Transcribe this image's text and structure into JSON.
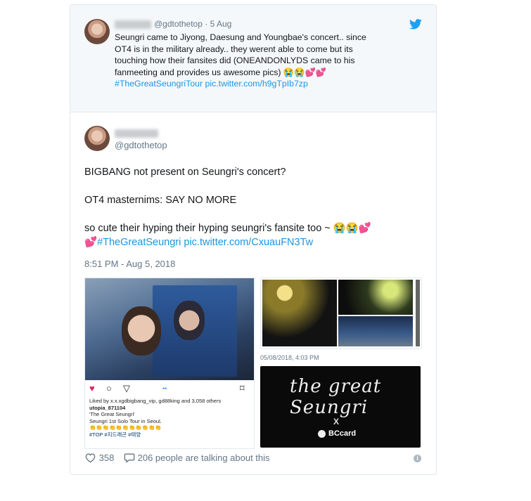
{
  "quoted_tweet": {
    "handle": "@gdtothetop",
    "separator": "·",
    "date": "5 Aug",
    "text_line1": "Seungri came to Jiyong, Daesung and Youngbae's concert.. since",
    "text_line2": "OT4 is in the military already.. they werent able to come but its",
    "text_line3": "touching how their fansites did (ONEANDONLYDS came to his",
    "text_line4": "fanmeeting and provides us awesome pics) 😭😭💕💕",
    "hashtag": "#TheGreatSeungriTour",
    "link": "pic.twitter.com/h9gTpIb7zp"
  },
  "main_tweet": {
    "handle": "@gdtothetop",
    "line1": "BIGBANG not present on Seungri's concert?",
    "line2": "OT4 masternims: SAY NO MORE",
    "line3": "so cute their hyping their hyping seungri's fansite too ~ 😭😭💕",
    "line4_prefix": "💕",
    "hashtag": "#TheGreatSeungri",
    "link": "pic.twitter.com/CxuauFN3Tw",
    "timestamp": "8:51 PM - Aug 5, 2018"
  },
  "media": {
    "instagram": {
      "likes": "Liked by x.x.xgdbigbang_vip, gd88king and 3,058 others",
      "user": "utopia_871104",
      "caption1": "'The Great Seungri'",
      "caption2": "Seungri 1st Solo Tour in Seoul.",
      "claps": "👏👏👏👏👏👏👏👏👏👏👏",
      "tags": "#TOP #지드래곤 #태양"
    },
    "date_stamp": "05/08/2018, 4:03 PM",
    "title_art": "the great Seungri",
    "x_mark": "X",
    "sponsor": "BCcard"
  },
  "footer": {
    "likes": "358",
    "talking": "206 people are talking about this"
  },
  "colors": {
    "link": "#1b95e0",
    "muted": "#657786",
    "like_red": "#e0245e"
  }
}
